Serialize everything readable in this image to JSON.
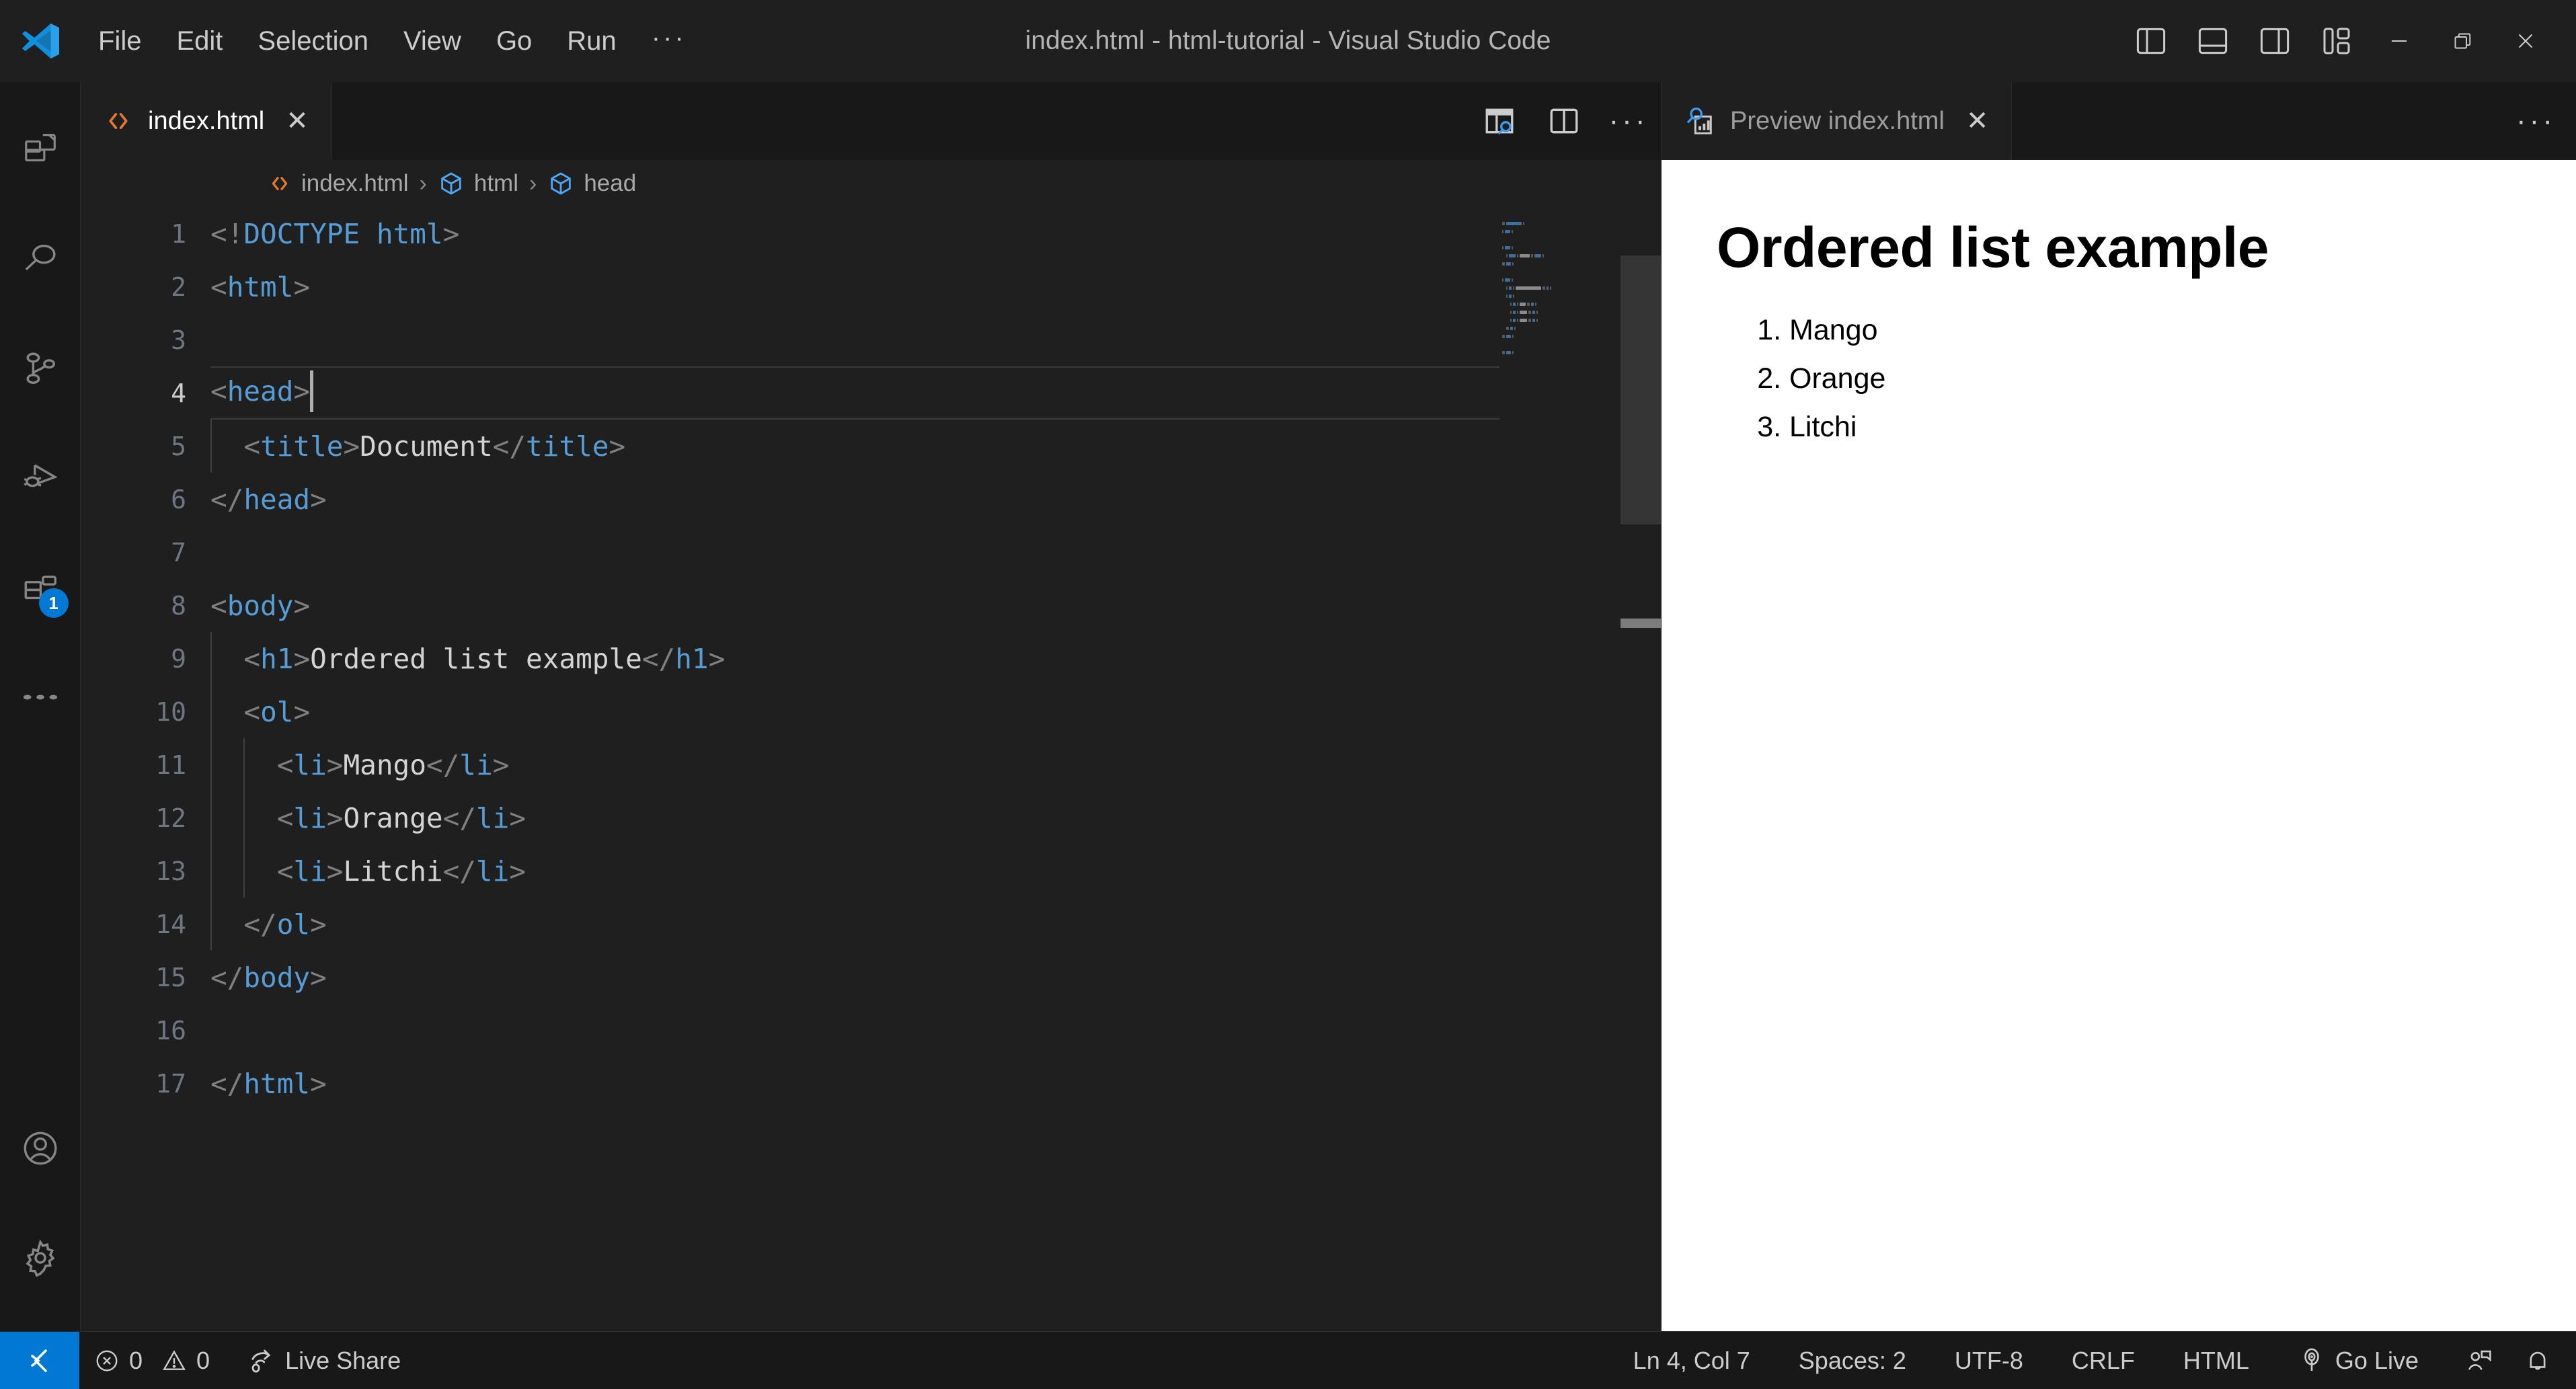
{
  "titlebar": {
    "app_title": "index.html - html-tutorial - Visual Studio Code",
    "menus": [
      "File",
      "Edit",
      "Selection",
      "View",
      "Go",
      "Run",
      "···"
    ],
    "layout_buttons": [
      {
        "name": "toggle-primary-sidebar",
        "tooltip": "Toggle Primary Side Bar"
      },
      {
        "name": "toggle-panel",
        "tooltip": "Toggle Panel"
      },
      {
        "name": "toggle-secondary-sidebar",
        "tooltip": "Toggle Secondary Side Bar"
      },
      {
        "name": "customize-layout",
        "tooltip": "Customize Layout"
      }
    ],
    "window_controls": {
      "minimize": "─",
      "restore": "❐",
      "close": "✕"
    }
  },
  "activitybar": {
    "items": [
      {
        "name": "explorer",
        "label": "Explorer",
        "badge": null
      },
      {
        "name": "search",
        "label": "Search",
        "badge": null
      },
      {
        "name": "source-control",
        "label": "Source Control",
        "badge": null
      },
      {
        "name": "run-and-debug",
        "label": "Run and Debug",
        "badge": null
      },
      {
        "name": "extensions",
        "label": "Extensions",
        "badge": "1"
      },
      {
        "name": "more",
        "label": "Additional Views",
        "badge": null
      }
    ],
    "bottom_items": [
      {
        "name": "accounts",
        "label": "Accounts"
      },
      {
        "name": "settings",
        "label": "Manage"
      }
    ]
  },
  "editor": {
    "tab": {
      "label": "index.html",
      "icon": "html-file-icon",
      "close": "✕"
    },
    "toolbar": [
      {
        "name": "open-preview-to-side",
        "label": "Open Preview to the Side"
      },
      {
        "name": "split-editor-right",
        "label": "Split Editor Right"
      },
      {
        "name": "more-actions",
        "label": "More Actions..."
      }
    ],
    "breadcrumbs": [
      {
        "label": "index.html",
        "icon": "html-file-icon"
      },
      {
        "label": "html",
        "icon": "symbol-field-icon"
      },
      {
        "label": "head",
        "icon": "symbol-field-icon"
      }
    ],
    "breadcrumb_separator": "›",
    "cursor_line": 4,
    "lines": [
      {
        "n": 1,
        "indent": 0,
        "tokens": [
          {
            "t": "pun",
            "v": "<!"
          },
          {
            "t": "tag",
            "v": "DOCTYPE html"
          },
          {
            "t": "pun",
            "v": ">"
          }
        ]
      },
      {
        "n": 2,
        "indent": 0,
        "tokens": [
          {
            "t": "pun",
            "v": "<"
          },
          {
            "t": "tag",
            "v": "html"
          },
          {
            "t": "pun",
            "v": ">"
          }
        ]
      },
      {
        "n": 3,
        "indent": 0,
        "tokens": []
      },
      {
        "n": 4,
        "indent": 0,
        "tokens": [
          {
            "t": "pun",
            "v": "<"
          },
          {
            "t": "tag",
            "v": "head"
          },
          {
            "t": "pun",
            "v": ">"
          }
        ]
      },
      {
        "n": 5,
        "indent": 1,
        "tokens": [
          {
            "t": "pun",
            "v": "  <"
          },
          {
            "t": "tag",
            "v": "title"
          },
          {
            "t": "pun",
            "v": ">"
          },
          {
            "t": "txt",
            "v": "Document"
          },
          {
            "t": "pun",
            "v": "</"
          },
          {
            "t": "tag",
            "v": "title"
          },
          {
            "t": "pun",
            "v": ">"
          }
        ]
      },
      {
        "n": 6,
        "indent": 0,
        "tokens": [
          {
            "t": "pun",
            "v": "</"
          },
          {
            "t": "tag",
            "v": "head"
          },
          {
            "t": "pun",
            "v": ">"
          }
        ]
      },
      {
        "n": 7,
        "indent": 0,
        "tokens": []
      },
      {
        "n": 8,
        "indent": 0,
        "tokens": [
          {
            "t": "pun",
            "v": "<"
          },
          {
            "t": "tag",
            "v": "body"
          },
          {
            "t": "pun",
            "v": ">"
          }
        ]
      },
      {
        "n": 9,
        "indent": 1,
        "tokens": [
          {
            "t": "pun",
            "v": "  <"
          },
          {
            "t": "tag",
            "v": "h1"
          },
          {
            "t": "pun",
            "v": ">"
          },
          {
            "t": "txt",
            "v": "Ordered list example"
          },
          {
            "t": "pun",
            "v": "</"
          },
          {
            "t": "tag",
            "v": "h1"
          },
          {
            "t": "pun",
            "v": ">"
          }
        ]
      },
      {
        "n": 10,
        "indent": 1,
        "tokens": [
          {
            "t": "pun",
            "v": "  <"
          },
          {
            "t": "tag",
            "v": "ol"
          },
          {
            "t": "pun",
            "v": ">"
          }
        ]
      },
      {
        "n": 11,
        "indent": 2,
        "tokens": [
          {
            "t": "pun",
            "v": "    <"
          },
          {
            "t": "tag",
            "v": "li"
          },
          {
            "t": "pun",
            "v": ">"
          },
          {
            "t": "txt",
            "v": "Mango"
          },
          {
            "t": "pun",
            "v": "</"
          },
          {
            "t": "tag",
            "v": "li"
          },
          {
            "t": "pun",
            "v": ">"
          }
        ]
      },
      {
        "n": 12,
        "indent": 2,
        "tokens": [
          {
            "t": "pun",
            "v": "    <"
          },
          {
            "t": "tag",
            "v": "li"
          },
          {
            "t": "pun",
            "v": ">"
          },
          {
            "t": "txt",
            "v": "Orange"
          },
          {
            "t": "pun",
            "v": "</"
          },
          {
            "t": "tag",
            "v": "li"
          },
          {
            "t": "pun",
            "v": ">"
          }
        ]
      },
      {
        "n": 13,
        "indent": 2,
        "tokens": [
          {
            "t": "pun",
            "v": "    <"
          },
          {
            "t": "tag",
            "v": "li"
          },
          {
            "t": "pun",
            "v": ">"
          },
          {
            "t": "txt",
            "v": "Litchi"
          },
          {
            "t": "pun",
            "v": "</"
          },
          {
            "t": "tag",
            "v": "li"
          },
          {
            "t": "pun",
            "v": ">"
          }
        ]
      },
      {
        "n": 14,
        "indent": 1,
        "tokens": [
          {
            "t": "pun",
            "v": "  </"
          },
          {
            "t": "tag",
            "v": "ol"
          },
          {
            "t": "pun",
            "v": ">"
          }
        ]
      },
      {
        "n": 15,
        "indent": 0,
        "tokens": [
          {
            "t": "pun",
            "v": "</"
          },
          {
            "t": "tag",
            "v": "body"
          },
          {
            "t": "pun",
            "v": ">"
          }
        ]
      },
      {
        "n": 16,
        "indent": 0,
        "tokens": []
      },
      {
        "n": 17,
        "indent": 0,
        "tokens": [
          {
            "t": "pun",
            "v": "</"
          },
          {
            "t": "tag",
            "v": "html"
          },
          {
            "t": "pun",
            "v": ">"
          }
        ]
      }
    ]
  },
  "preview": {
    "tab": {
      "label": "Preview index.html",
      "icon": "preview-icon",
      "close": "✕"
    },
    "more_actions": "···",
    "heading": "Ordered list example",
    "list_items": [
      "Mango",
      "Orange",
      "Litchi"
    ]
  },
  "statusbar": {
    "remote_icon": "remote-window-icon",
    "errors": "0",
    "warnings": "0",
    "live_share": "Live Share",
    "cursor_position": "Ln 4, Col 7",
    "indentation": "Spaces: 2",
    "encoding": "UTF-8",
    "eol": "CRLF",
    "language": "HTML",
    "go_live": "Go Live",
    "feedback_icon": "feedback-icon",
    "bell_icon": "bell-icon"
  },
  "colors": {
    "accent": "#0078d4",
    "tag": "#569cd6",
    "punctuation": "#808080",
    "text": "#d4d4d4",
    "html_icon": "#e37933"
  }
}
